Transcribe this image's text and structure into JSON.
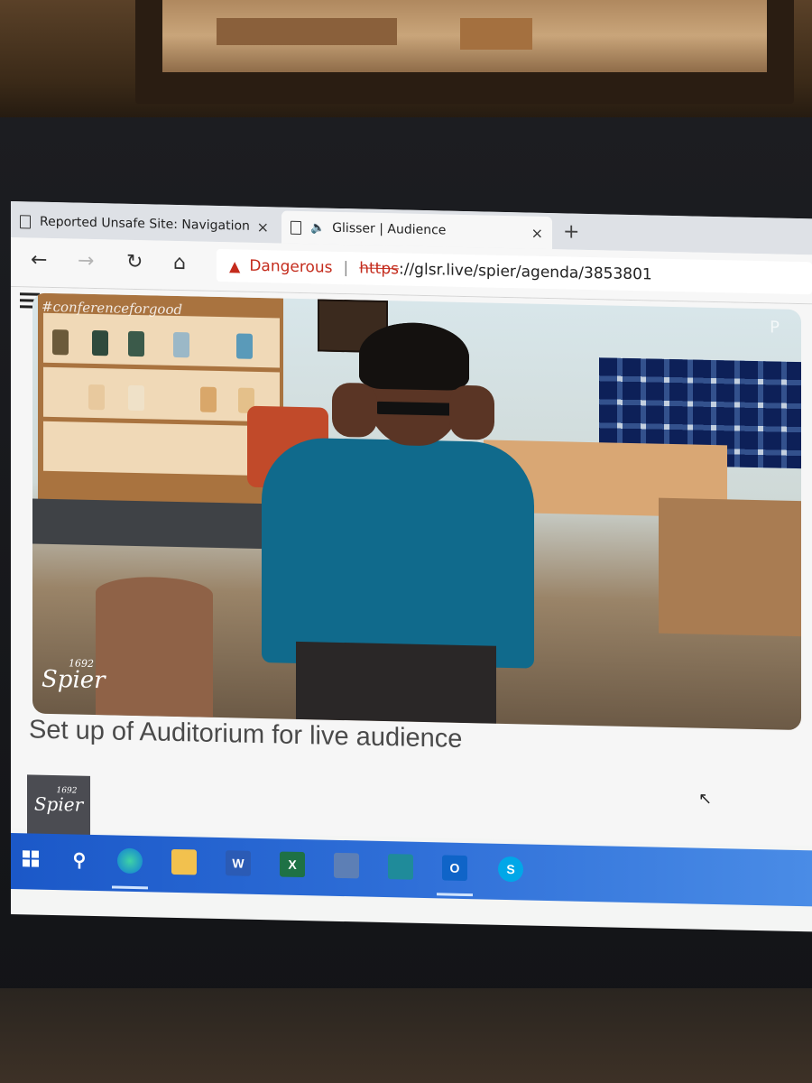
{
  "browser": {
    "tabs": [
      {
        "title": "Reported Unsafe Site: Navigation",
        "close": "×"
      },
      {
        "title": "Glisser | Audience",
        "close": "×",
        "audio_icon": "speaker-icon"
      }
    ],
    "new_tab": "+",
    "nav": {
      "back": "←",
      "forward": "→",
      "reload": "↻",
      "home": "⌂"
    },
    "address": {
      "warning_label": "Dangerous",
      "separator": "|",
      "scheme": "https",
      "rest": "://glsr.live/spier/agenda/3853801"
    }
  },
  "page": {
    "menu_icon": "hamburger-icon",
    "video": {
      "hashtag": "#conferenceforgood",
      "logo_year": "1692",
      "logo_name": "Spier",
      "corner_logo": "P"
    },
    "session_title": "Set up of Auditorium for live audience",
    "brand_logo": {
      "year": "1692",
      "name": "Spier"
    }
  },
  "taskbar": {
    "icons": [
      "windows-icon",
      "search-icon",
      "edge-icon",
      "file-explorer-icon",
      "word-icon",
      "excel-icon",
      "contacts-icon",
      "store-icon",
      "outlook-icon",
      "skype-icon"
    ],
    "labels": {
      "word": "W",
      "excel": "X",
      "outlook": "O",
      "skype": "S"
    }
  },
  "colors": {
    "danger": "#c42b1c",
    "taskbar": "#2f6fd8",
    "teal_top": "#106a8c"
  }
}
